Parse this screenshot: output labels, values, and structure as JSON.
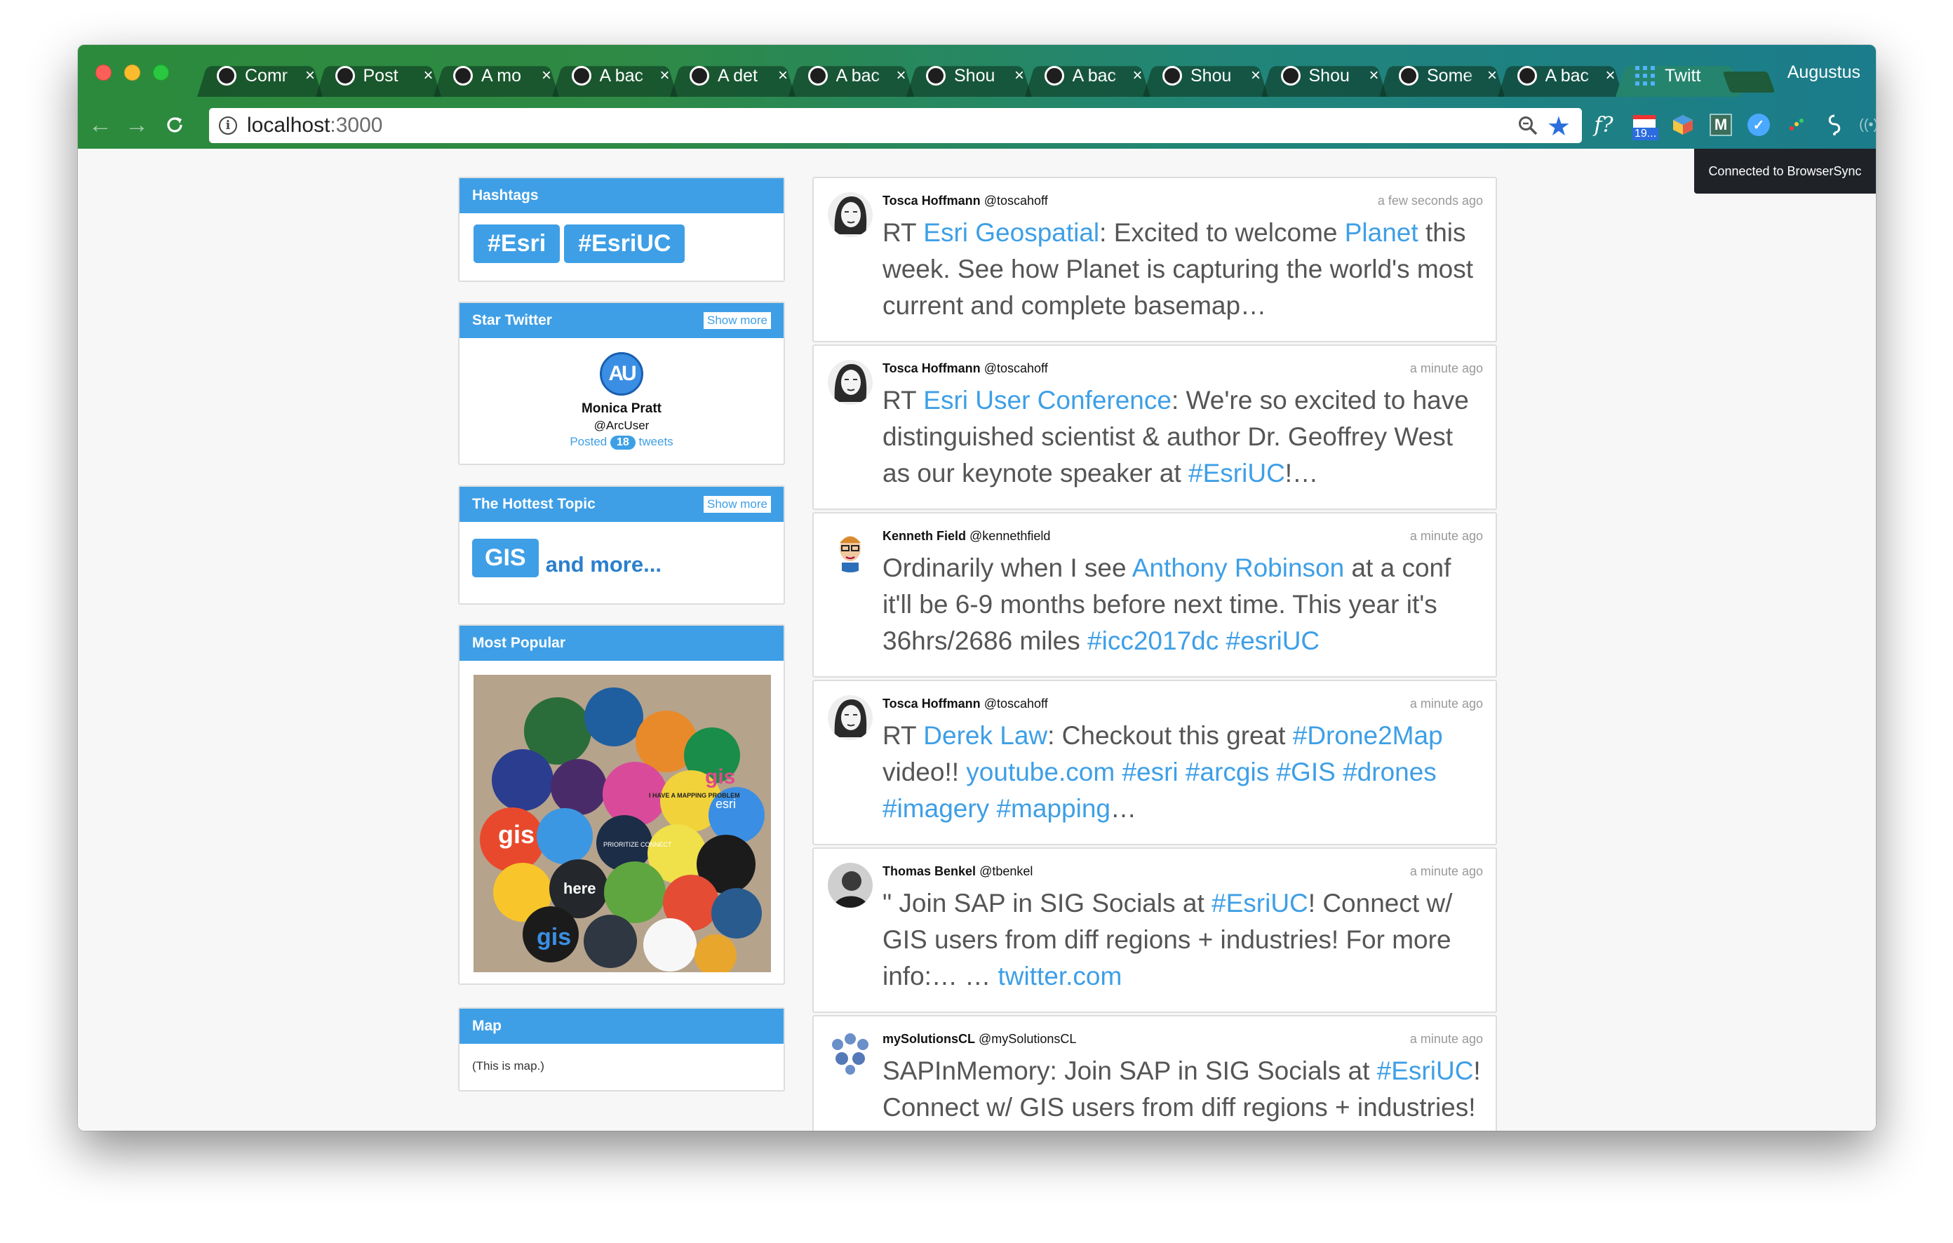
{
  "browser": {
    "tabs": [
      {
        "title": "Comr"
      },
      {
        "title": "Post"
      },
      {
        "title": "A mo"
      },
      {
        "title": "A bac"
      },
      {
        "title": "A det"
      },
      {
        "title": "A bac"
      },
      {
        "title": "Shou"
      },
      {
        "title": "A bac"
      },
      {
        "title": "Shou"
      },
      {
        "title": "Shou"
      },
      {
        "title": "Some"
      },
      {
        "title": "A bac"
      },
      {
        "title": "Twitt"
      }
    ],
    "close_glyph": "×",
    "profile_name": "Augustus",
    "url_host": "localhost",
    "url_port": ":3000",
    "ext_badge": "19...",
    "ext_font_label": "f?",
    "ext_m_label": "M"
  },
  "browsersync_notice": "Connected to BrowserSync",
  "sidebar": {
    "hashtags": {
      "title": "Hashtags",
      "tags": [
        "#Esri",
        "#EsriUC"
      ]
    },
    "star_twitter": {
      "title": "Star Twitter",
      "show_more": "Show more",
      "avatar_text": "AU",
      "name": "Monica Pratt",
      "handle": "@ArcUser",
      "posted_prefix": "Posted",
      "count": "18",
      "posted_suffix": "tweets"
    },
    "hottest_topic": {
      "title": "The Hottest Topic",
      "show_more": "Show more",
      "topic": "GIS",
      "more": "and more..."
    },
    "most_popular": {
      "title": "Most Popular",
      "photo_labels": [
        "gis",
        "esri",
        "here",
        "gis",
        "I HAVE A MAPPING PROBLEM",
        "PRIORITIZE CONNECT",
        "gis"
      ]
    },
    "map": {
      "title": "Map",
      "text": "(This is map.)"
    }
  },
  "tweets": [
    {
      "name": "Tosca Hoffmann",
      "handle": "@toscahoff",
      "time": "a few seconds ago",
      "avatar": "sketch-face",
      "parts": [
        {
          "t": "RT "
        },
        {
          "t": "Esri Geospatial",
          "l": true
        },
        {
          "t": ": Excited to welcome "
        },
        {
          "t": "Planet",
          "l": true
        },
        {
          "t": " this week. See how Planet is capturing the world's most current and complete basemap…"
        }
      ]
    },
    {
      "name": "Tosca Hoffmann",
      "handle": "@toscahoff",
      "time": "a minute ago",
      "avatar": "sketch-face",
      "parts": [
        {
          "t": "RT "
        },
        {
          "t": "Esri User Conference",
          "l": true
        },
        {
          "t": ": We're so excited to have distinguished scientist & author Dr. Geoffrey West as our keynote speaker at "
        },
        {
          "t": "#EsriUC",
          "l": true
        },
        {
          "t": "!…"
        }
      ]
    },
    {
      "name": "Kenneth Field",
      "handle": "@kennethfield",
      "time": "a minute ago",
      "avatar": "cartoon-man",
      "parts": [
        {
          "t": "Ordinarily when I see "
        },
        {
          "t": "Anthony Robinson",
          "l": true
        },
        {
          "t": " at a conf it'll be 6-9 months before next time. This year it's 36hrs/2686 miles "
        },
        {
          "t": "#icc2017dc",
          "l": true
        },
        {
          "t": " "
        },
        {
          "t": "#esriUC",
          "l": true
        }
      ]
    },
    {
      "name": "Tosca Hoffmann",
      "handle": "@toscahoff",
      "time": "a minute ago",
      "avatar": "sketch-face",
      "parts": [
        {
          "t": "RT "
        },
        {
          "t": "Derek Law",
          "l": true
        },
        {
          "t": ": Checkout this great "
        },
        {
          "t": "#Drone2Map",
          "l": true
        },
        {
          "t": " video!! "
        },
        {
          "t": "youtube.com",
          "l": true
        },
        {
          "t": " "
        },
        {
          "t": "#esri",
          "l": true
        },
        {
          "t": " "
        },
        {
          "t": "#arcgis",
          "l": true
        },
        {
          "t": " "
        },
        {
          "t": "#GIS",
          "l": true
        },
        {
          "t": " "
        },
        {
          "t": "#drones",
          "l": true
        },
        {
          "t": " "
        },
        {
          "t": "#imagery",
          "l": true
        },
        {
          "t": " "
        },
        {
          "t": "#mapping",
          "l": true
        },
        {
          "t": "…"
        }
      ]
    },
    {
      "name": "Thomas Benkel",
      "handle": "@tbenkel",
      "time": "a minute ago",
      "avatar": "bw-portrait",
      "parts": [
        {
          "t": "\" Join SAP in SIG Socials at "
        },
        {
          "t": "#EsriUC",
          "l": true
        },
        {
          "t": "! Connect w/ GIS users from diff regions + industries! For more info:… … "
        },
        {
          "t": "twitter.com",
          "l": true
        }
      ]
    },
    {
      "name": "mySolutionsCL",
      "handle": "@mySolutionsCL",
      "time": "a minute ago",
      "avatar": "blue-dots",
      "parts": [
        {
          "t": "SAPInMemory: Join SAP in SIG Socials at "
        },
        {
          "t": "#EsriUC",
          "l": true
        },
        {
          "t": "! Connect w/ GIS users from diff regions + industries!"
        }
      ]
    }
  ]
}
